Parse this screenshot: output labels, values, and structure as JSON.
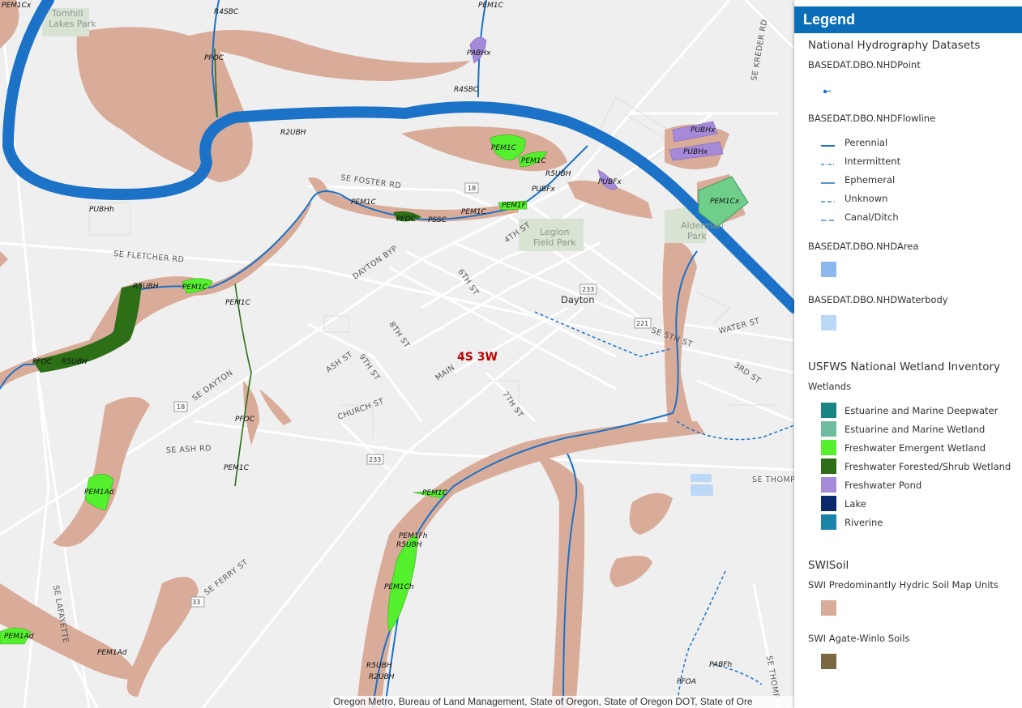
{
  "map": {
    "township_label": "4S 3W",
    "city_label": "Dayton",
    "parks": [
      "Legion Field Park",
      "Alderman Park",
      "Tomhill Lakes Park"
    ],
    "roads": [
      "SE FOSTER RD",
      "SE FLETCHER RD",
      "DAYTON BYP",
      "SE DAYTON",
      "SE ASH RD",
      "SE FERRY ST",
      "SE LAFAYETTE",
      "SE KREDER RD",
      "WATER ST",
      "3RD ST",
      "SE THOMP",
      "4TH ST",
      "5TH ST",
      "6TH ST",
      "8TH ST",
      "9TH ST",
      "ASH ST",
      "MAIN",
      "CHURCH ST",
      "7TH ST",
      "SE THOMP"
    ],
    "shields": [
      "18",
      "18",
      "233",
      "233",
      "221",
      "233"
    ],
    "wetland_labels": [
      "PEM1Cx",
      "R4SBC",
      "PEM1C",
      "PABHx",
      "PFOC",
      "R4SBC",
      "R2UBH",
      "PEM1C",
      "PEM1C",
      "PUBHx",
      "PUBHx",
      "PEM1Cx",
      "R5UBH",
      "PUBFx",
      "PUBFx",
      "PUBHh",
      "PEM1C",
      "PFOC",
      "PSSC",
      "PEM1C",
      "PEM1F",
      "R5UBH",
      "PEM1C",
      "PEM1C",
      "PFOC",
      "R5UBH",
      "PFOC",
      "PEM1C",
      "PEM1Ad",
      "PEM1C",
      "PEM1Fh",
      "R5UBH",
      "PEM1Ch",
      "R5UBH",
      "R2UBH",
      "PEM1Ad",
      "PEM1Ad",
      "PABFh",
      "PFOA"
    ],
    "attribution": "Oregon Metro, Bureau of Land Management, State of Oregon, State of Oregon DOT, State of Ore"
  },
  "legend": {
    "title": "Legend",
    "nhd_group": "National Hydrography Datasets",
    "nhd_point": "BASEDAT.DBO.NHDPoint",
    "nhd_flowline": "BASEDAT.DBO.NHDFlowline",
    "flowline_items": [
      "Perennial",
      "Intermittent",
      "Ephemeral",
      "Unknown",
      "Canal/Ditch"
    ],
    "nhd_area": "BASEDAT.DBO.NHDArea",
    "nhd_waterbody": "BASEDAT.DBO.NHDWaterbody",
    "nwi_group": "USFWS National Wetland Inventory",
    "wetlands_layer": "Wetlands",
    "wetland_items": [
      "Estuarine and Marine Deepwater",
      "Estuarine and Marine Wetland",
      "Freshwater Emergent Wetland",
      "Freshwater Forested/Shrub Wetland",
      "Freshwater Pond",
      "Lake",
      "Riverine"
    ],
    "wetland_colors": [
      "#1a8585",
      "#6fbd9e",
      "#55f02d",
      "#2d6f16",
      "#a48ad8",
      "#0b2a6b",
      "#1a84a8"
    ],
    "soil_group": "SWISoil",
    "soil_items": [
      "SWI Predominantly Hydric Soil Map Units",
      "SWI Agate-Winlo Soils"
    ],
    "soil_colors": [
      "#d9ac9a",
      "#7a6842"
    ],
    "flow_color": "#1e6fc4",
    "area_color": "#8cb8f0",
    "waterbody_color": "#bcd8f7"
  }
}
